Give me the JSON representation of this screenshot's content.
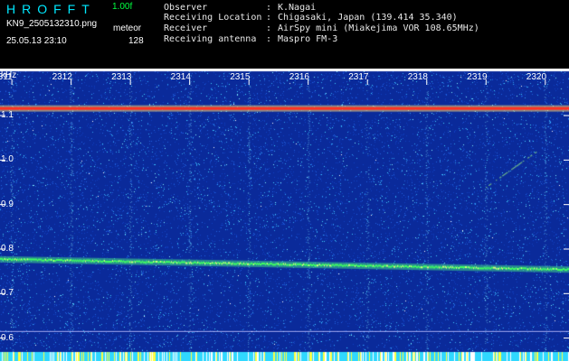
{
  "header": {
    "app_title": "HROFFT",
    "app_version": "1.00f",
    "file_name": "KN9_2505132310.png",
    "meteor_label": "meteor",
    "timestamp": "25.05.13 23:10",
    "meteor_count": "128"
  },
  "info": [
    {
      "key": "Observer",
      "colon": ":",
      "value": "K.Nagai"
    },
    {
      "key": "Receiving Location",
      "colon": ":",
      "value": "Chigasaki, Japan (139.414 35.340)"
    },
    {
      "key": "Receiver",
      "colon": ":",
      "value": "AirSpy mini (Miakejima VOR 108.65MHz)"
    },
    {
      "key": "Receiving antenna",
      "colon": ":",
      "value": "Maspro FM-3"
    }
  ],
  "chart_data": {
    "type": "heatmap",
    "ylabel": "kHz",
    "y_ticks": [
      "1.1",
      "1.0",
      "0.9",
      "0.8",
      "0.7",
      "0.6"
    ],
    "y_tick_values": [
      1.1,
      1.0,
      0.9,
      0.8,
      0.7,
      0.6
    ],
    "ylim": [
      0.585,
      1.165
    ],
    "x_ticks": [
      "2311",
      "2312",
      "2313",
      "2314",
      "2315",
      "2316",
      "2317",
      "2318",
      "2319",
      "2320"
    ],
    "xlim_minutes": [
      2310.8,
      2320.4
    ],
    "features": [
      {
        "name": "carrier",
        "freq_khz": 1.117,
        "color": "#ff3020"
      },
      {
        "name": "reference-tone",
        "freq_khz_start": 0.778,
        "freq_khz_end": 0.755,
        "color": "#40ff60"
      },
      {
        "name": "meteor-echo",
        "minute_start": 2319.0,
        "minute_end": 2319.85,
        "freq_khz_start": 0.94,
        "freq_khz_end": 1.02,
        "color": "#a0ff80"
      }
    ],
    "colors": {
      "background": "#0a2a9a",
      "noise": "#38c8ff",
      "bottom_bar": "#30d8ff"
    }
  }
}
